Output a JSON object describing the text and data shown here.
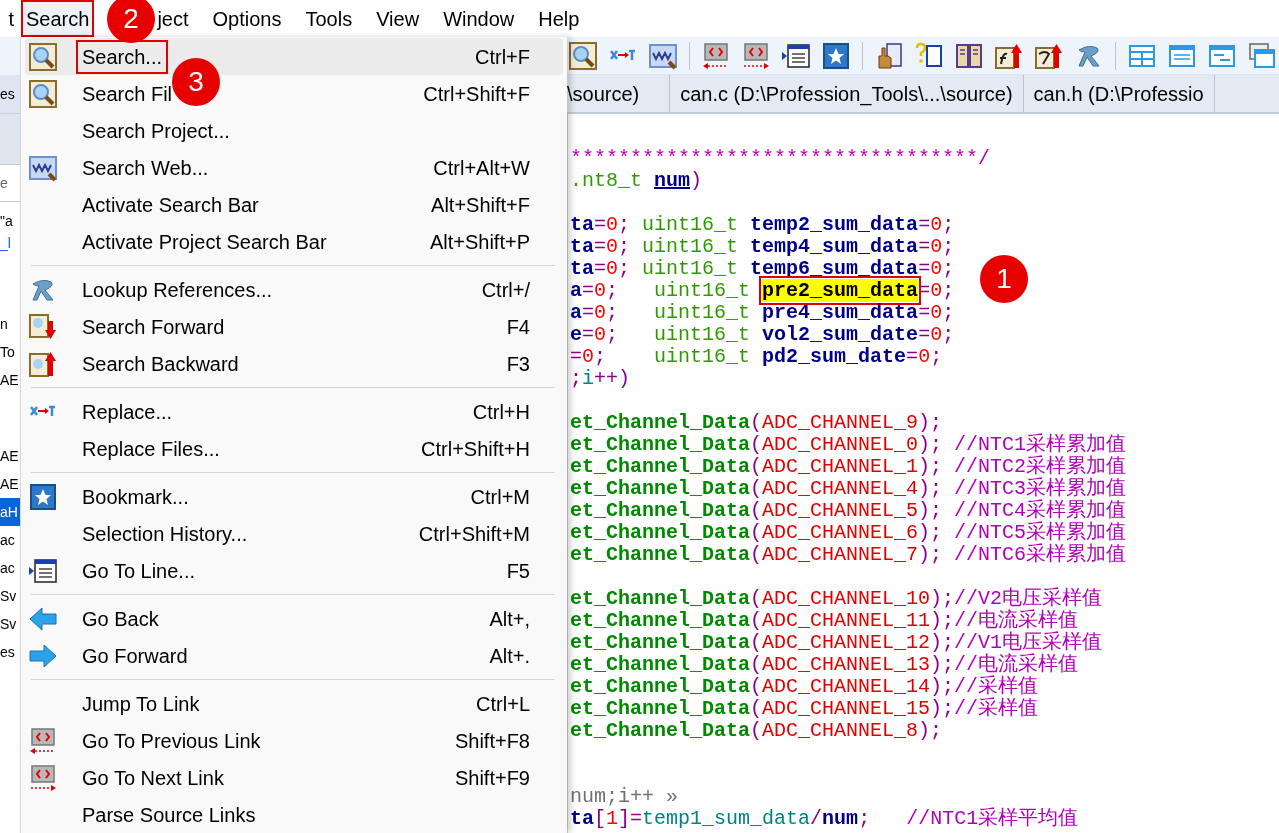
{
  "menu_bar": [
    {
      "label": "t",
      "selected": false,
      "boxed": false
    },
    {
      "label": "Search",
      "selected": true,
      "boxed": true
    },
    {
      "label": "ject",
      "selected": false,
      "boxed": false
    },
    {
      "label": "Options",
      "selected": false,
      "boxed": false
    },
    {
      "label": "Tools",
      "selected": false,
      "boxed": false
    },
    {
      "label": "View",
      "selected": false,
      "boxed": false
    },
    {
      "label": "Window",
      "selected": false,
      "boxed": false
    },
    {
      "label": "Help",
      "selected": false,
      "boxed": false
    }
  ],
  "left_panel": {
    "tab_fragment": "es",
    "field_fragment": "e",
    "lines": [
      "\"a",
      "_l"
    ],
    "list": [
      {
        "text": "n",
        "selected": false
      },
      {
        "text": "To",
        "selected": false
      },
      {
        "text": "AE",
        "selected": false
      },
      {
        "text": "AE",
        "selected": false
      },
      {
        "text": "AE",
        "selected": false
      },
      {
        "text": "aH",
        "selected": true
      },
      {
        "text": "ac",
        "selected": false
      },
      {
        "text": "ac",
        "selected": false
      },
      {
        "text": "Sv",
        "selected": false
      },
      {
        "text": "Sv",
        "selected": false
      },
      {
        "text": "es",
        "selected": false
      }
    ]
  },
  "search_menu": [
    {
      "kind": "search",
      "label": "Search...",
      "shortcut": "Ctrl+F",
      "selected": true,
      "boxed": true
    },
    {
      "kind": "search",
      "label": "Search Fil",
      "shortcut": "Ctrl+Shift+F",
      "selected": false,
      "boxed": false
    },
    {
      "kind": "plain",
      "label": "Search Project...",
      "selected": false,
      "boxed": false
    },
    {
      "kind": "web",
      "label": "Search Web...",
      "shortcut": "Ctrl+Alt+W",
      "selected": false,
      "boxed": false
    },
    {
      "kind": "plain",
      "label": "Activate Search Bar",
      "shortcut": "Alt+Shift+F",
      "selected": false,
      "boxed": false
    },
    {
      "kind": "plain",
      "label": "Activate Project Search Bar",
      "shortcut": "Alt+Shift+P",
      "selected": false,
      "boxed": false
    },
    {
      "kind": "separator"
    },
    {
      "kind": "references",
      "label": "Lookup References...",
      "shortcut": "Ctrl+/",
      "selected": false,
      "boxed": false
    },
    {
      "kind": "forward",
      "label": "Search Forward",
      "shortcut": "F4",
      "selected": false,
      "boxed": false
    },
    {
      "kind": "backward",
      "label": "Search Backward",
      "shortcut": "F3",
      "selected": false,
      "boxed": false
    },
    {
      "kind": "separator"
    },
    {
      "kind": "replace",
      "label": "Replace...",
      "shortcut": "Ctrl+H",
      "selected": false,
      "boxed": false
    },
    {
      "kind": "plain",
      "label": "Replace Files...",
      "shortcut": "Ctrl+Shift+H",
      "selected": false,
      "boxed": false
    },
    {
      "kind": "separator"
    },
    {
      "kind": "bookmark",
      "label": "Bookmark...",
      "shortcut": "Ctrl+M",
      "selected": false,
      "boxed": false
    },
    {
      "kind": "plain",
      "label": "Selection History...",
      "shortcut": "Ctrl+Shift+M",
      "selected": false,
      "boxed": false
    },
    {
      "kind": "goto",
      "label": "Go To Line...",
      "shortcut": "F5",
      "selected": false,
      "boxed": false
    },
    {
      "kind": "separator"
    },
    {
      "kind": "back",
      "label": "Go Back",
      "shortcut": "Alt+,",
      "selected": false,
      "boxed": false
    },
    {
      "kind": "next",
      "label": "Go Forward",
      "shortcut": "Alt+.",
      "selected": false,
      "boxed": false
    },
    {
      "kind": "separator"
    },
    {
      "kind": "plain",
      "label": "Jump To Link",
      "shortcut": "Ctrl+L",
      "selected": false,
      "boxed": false
    },
    {
      "kind": "prev_link",
      "label": "Go To Previous Link",
      "shortcut": "Shift+F8",
      "selected": false,
      "boxed": false
    },
    {
      "kind": "next_link",
      "label": "Go To Next Link",
      "shortcut": "Shift+F9",
      "selected": false,
      "boxed": false
    },
    {
      "kind": "plain",
      "label": "Parse Source Links",
      "selected": false,
      "boxed": false
    }
  ],
  "tabs": [
    {
      "label": "\\source)"
    },
    {
      "label": "can.c (D:\\Profession_Tools\\...\\source)"
    },
    {
      "label": "can.h (D:\\Professio"
    }
  ],
  "code_blocks": [
    {
      "kind": "header",
      "lines": [
        [
          {
            "kind": "comment",
            "text": "**********************************/"
          }
        ],
        [
          {
            "kind": "type",
            "text": ".nt8_t "
          },
          {
            "kind": "param",
            "text": "num"
          },
          {
            "kind": "punct",
            "text": ")"
          }
        ]
      ]
    },
    {
      "kind": "code",
      "lines": [
        [
          {
            "kind": "ident",
            "text": "ta"
          },
          {
            "kind": "punct",
            "text": "="
          },
          {
            "kind": "num",
            "text": "0"
          },
          {
            "kind": "punct",
            "text": "; "
          },
          {
            "kind": "type",
            "text": "uint16_t "
          },
          {
            "kind": "ident",
            "text": "temp2_sum_data"
          },
          {
            "kind": "punct",
            "text": "="
          },
          {
            "kind": "num",
            "text": "0"
          },
          {
            "kind": "punct",
            "text": ";"
          }
        ],
        [
          {
            "kind": "ident",
            "text": "ta"
          },
          {
            "kind": "punct",
            "text": "="
          },
          {
            "kind": "num",
            "text": "0"
          },
          {
            "kind": "punct",
            "text": "; "
          },
          {
            "kind": "type",
            "text": "uint16_t "
          },
          {
            "kind": "ident",
            "text": "temp4_sum_data"
          },
          {
            "kind": "punct",
            "text": "="
          },
          {
            "kind": "num",
            "text": "0"
          },
          {
            "kind": "punct",
            "text": ";"
          }
        ],
        [
          {
            "kind": "ident",
            "text": "ta"
          },
          {
            "kind": "punct",
            "text": "="
          },
          {
            "kind": "num",
            "text": "0"
          },
          {
            "kind": "punct",
            "text": "; "
          },
          {
            "kind": "type",
            "text": "uint16_t "
          },
          {
            "kind": "ident",
            "text": "temp6_sum_data"
          },
          {
            "kind": "punct",
            "text": "="
          },
          {
            "kind": "num",
            "text": "0"
          },
          {
            "kind": "punct",
            "text": ";"
          }
        ],
        [
          {
            "kind": "ident",
            "text": "a"
          },
          {
            "kind": "punct",
            "text": "="
          },
          {
            "kind": "num",
            "text": "0"
          },
          {
            "kind": "punct",
            "text": ";   "
          },
          {
            "kind": "type",
            "text": "uint16_t "
          },
          {
            "kind": "found",
            "text": "pre2_sum_data"
          },
          {
            "kind": "punct",
            "text": "="
          },
          {
            "kind": "num",
            "text": "0"
          },
          {
            "kind": "punct",
            "text": ";"
          }
        ],
        [
          {
            "kind": "ident",
            "text": "a"
          },
          {
            "kind": "punct",
            "text": "="
          },
          {
            "kind": "num",
            "text": "0"
          },
          {
            "kind": "punct",
            "text": ";   "
          },
          {
            "kind": "type",
            "text": "uint16_t "
          },
          {
            "kind": "ident",
            "text": "pre4_sum_data"
          },
          {
            "kind": "punct",
            "text": "="
          },
          {
            "kind": "num",
            "text": "0"
          },
          {
            "kind": "punct",
            "text": ";"
          }
        ],
        [
          {
            "kind": "ident",
            "text": "e"
          },
          {
            "kind": "punct",
            "text": "="
          },
          {
            "kind": "num",
            "text": "0"
          },
          {
            "kind": "punct",
            "text": ";   "
          },
          {
            "kind": "type",
            "text": "uint16_t "
          },
          {
            "kind": "ident",
            "text": "vol2_sum_date"
          },
          {
            "kind": "punct",
            "text": "="
          },
          {
            "kind": "num",
            "text": "0"
          },
          {
            "kind": "punct",
            "text": ";"
          }
        ],
        [
          {
            "kind": "punct",
            "text": "="
          },
          {
            "kind": "num",
            "text": "0"
          },
          {
            "kind": "punct",
            "text": ";    "
          },
          {
            "kind": "type",
            "text": "uint16_t "
          },
          {
            "kind": "ident",
            "text": "pd2_sum_date"
          },
          {
            "kind": "punct",
            "text": "="
          },
          {
            "kind": "num",
            "text": "0"
          },
          {
            "kind": "punct",
            "text": ";"
          }
        ],
        [
          {
            "kind": "punct",
            "text": ";"
          },
          {
            "kind": "var",
            "text": "i"
          },
          {
            "kind": "punct",
            "text": "++)"
          }
        ]
      ]
    },
    {
      "kind": "code",
      "lines": [
        [
          {
            "kind": "fn",
            "text": "et_Channel_Data"
          },
          {
            "kind": "punct",
            "text": "("
          },
          {
            "kind": "macro",
            "text": "ADC_CHANNEL_9"
          },
          {
            "kind": "punct",
            "text": ");"
          }
        ],
        [
          {
            "kind": "fn",
            "text": "et_Channel_Data"
          },
          {
            "kind": "punct",
            "text": "("
          },
          {
            "kind": "macro",
            "text": "ADC_CHANNEL_0"
          },
          {
            "kind": "punct",
            "text": "); "
          },
          {
            "kind": "comment",
            "text": "//NTC1采样累加值"
          }
        ],
        [
          {
            "kind": "fn",
            "text": "et_Channel_Data"
          },
          {
            "kind": "punct",
            "text": "("
          },
          {
            "kind": "macro",
            "text": "ADC_CHANNEL_1"
          },
          {
            "kind": "punct",
            "text": "); "
          },
          {
            "kind": "comment",
            "text": "//NTC2采样累加值"
          }
        ],
        [
          {
            "kind": "fn",
            "text": "et_Channel_Data"
          },
          {
            "kind": "punct",
            "text": "("
          },
          {
            "kind": "macro",
            "text": "ADC_CHANNEL_4"
          },
          {
            "kind": "punct",
            "text": "); "
          },
          {
            "kind": "comment",
            "text": "//NTC3采样累加值"
          }
        ],
        [
          {
            "kind": "fn",
            "text": "et_Channel_Data"
          },
          {
            "kind": "punct",
            "text": "("
          },
          {
            "kind": "macro",
            "text": "ADC_CHANNEL_5"
          },
          {
            "kind": "punct",
            "text": "); "
          },
          {
            "kind": "comment",
            "text": "//NTC4采样累加值"
          }
        ],
        [
          {
            "kind": "fn",
            "text": "et_Channel_Data"
          },
          {
            "kind": "punct",
            "text": "("
          },
          {
            "kind": "macro",
            "text": "ADC_CHANNEL_6"
          },
          {
            "kind": "punct",
            "text": "); "
          },
          {
            "kind": "comment",
            "text": "//NTC5采样累加值"
          }
        ],
        [
          {
            "kind": "fn",
            "text": "et_Channel_Data"
          },
          {
            "kind": "punct",
            "text": "("
          },
          {
            "kind": "macro",
            "text": "ADC_CHANNEL_7"
          },
          {
            "kind": "punct",
            "text": "); "
          },
          {
            "kind": "comment",
            "text": "//NTC6采样累加值"
          }
        ]
      ]
    },
    {
      "kind": "code",
      "lines": [
        [
          {
            "kind": "fn",
            "text": "et_Channel_Data"
          },
          {
            "kind": "punct",
            "text": "("
          },
          {
            "kind": "macro",
            "text": "ADC_CHANNEL_10"
          },
          {
            "kind": "punct",
            "text": ");"
          },
          {
            "kind": "comment",
            "text": "//V2电压采样值"
          }
        ],
        [
          {
            "kind": "fn",
            "text": "et_Channel_Data"
          },
          {
            "kind": "punct",
            "text": "("
          },
          {
            "kind": "macro",
            "text": "ADC_CHANNEL_11"
          },
          {
            "kind": "punct",
            "text": ");"
          },
          {
            "kind": "comment",
            "text": "//电流采样值"
          }
        ],
        [
          {
            "kind": "fn",
            "text": "et_Channel_Data"
          },
          {
            "kind": "punct",
            "text": "("
          },
          {
            "kind": "macro",
            "text": "ADC_CHANNEL_12"
          },
          {
            "kind": "punct",
            "text": ");"
          },
          {
            "kind": "comment",
            "text": "//V1电压采样值"
          }
        ],
        [
          {
            "kind": "fn",
            "text": "et_Channel_Data"
          },
          {
            "kind": "punct",
            "text": "("
          },
          {
            "kind": "macro",
            "text": "ADC_CHANNEL_13"
          },
          {
            "kind": "punct",
            "text": ");"
          },
          {
            "kind": "comment",
            "text": "//电流采样值"
          }
        ],
        [
          {
            "kind": "fn",
            "text": "et_Channel_Data"
          },
          {
            "kind": "punct",
            "text": "("
          },
          {
            "kind": "macro",
            "text": "ADC_CHANNEL_14"
          },
          {
            "kind": "punct",
            "text": ");"
          },
          {
            "kind": "comment",
            "text": "//采样值"
          }
        ],
        [
          {
            "kind": "fn",
            "text": "et_Channel_Data"
          },
          {
            "kind": "punct",
            "text": "("
          },
          {
            "kind": "macro",
            "text": "ADC_CHANNEL_15"
          },
          {
            "kind": "punct",
            "text": ");"
          },
          {
            "kind": "comment",
            "text": "//采样值"
          }
        ],
        [
          {
            "kind": "fn",
            "text": "et_Channel_Data"
          },
          {
            "kind": "punct",
            "text": "("
          },
          {
            "kind": "macro",
            "text": "ADC_CHANNEL_8"
          },
          {
            "kind": "punct",
            "text": ");"
          }
        ]
      ]
    },
    {
      "kind": "fold",
      "lines": [
        [
          {
            "kind": "folded",
            "text": "num;i++ »"
          }
        ],
        [
          {
            "kind": "ident",
            "text": "ta"
          },
          {
            "kind": "punct",
            "text": "["
          },
          {
            "kind": "num",
            "text": "1"
          },
          {
            "kind": "punct",
            "text": "]="
          },
          {
            "kind": "var",
            "text": "temp1_sum_data"
          },
          {
            "kind": "punct",
            "text": "/"
          },
          {
            "kind": "ident",
            "text": "num"
          },
          {
            "kind": "punct",
            "text": ";   "
          },
          {
            "kind": "comment",
            "text": "//NTC1采样平均值"
          }
        ]
      ]
    }
  ],
  "callouts": [
    "1",
    "2",
    "3"
  ]
}
